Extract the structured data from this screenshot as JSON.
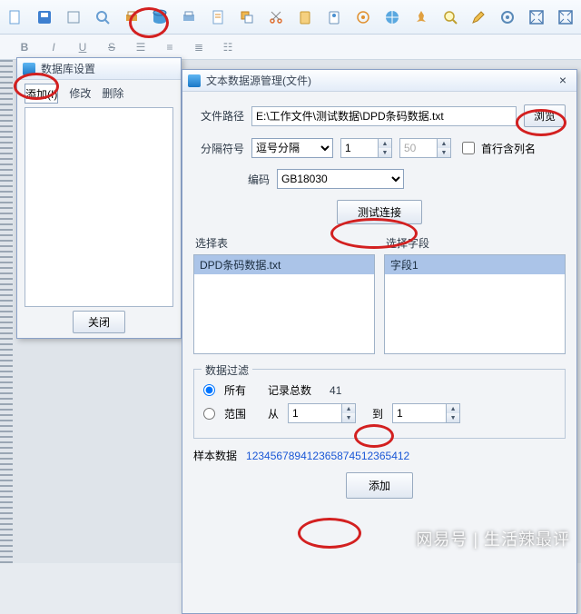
{
  "toolbar": {
    "icons": [
      "file",
      "save",
      "page",
      "zoom-in",
      "print",
      "database",
      "print2",
      "doc",
      "layers",
      "cut",
      "clip",
      "stamp",
      "target",
      "globe",
      "find",
      "edit",
      "settings",
      "fit",
      "fit2"
    ]
  },
  "format_bar": {
    "items": [
      "B",
      "I",
      "U",
      "S",
      "☰",
      "≡",
      "≣",
      "☷"
    ]
  },
  "db_dialog": {
    "title": "数据库设置",
    "add": "添加(I)",
    "modify": "修改",
    "delete": "删除",
    "close": "关闭"
  },
  "ds_dialog": {
    "title": "文本数据源管理(文件)",
    "path_label": "文件路径",
    "path_value": "E:\\工作文件\\测试数据\\DPD条码数据.txt",
    "browse": "浏览",
    "delim_label": "分隔符号",
    "delim_value": "逗号分隔",
    "spin1": "1",
    "spin2": "50",
    "first_row_cols": "首行含列名",
    "encoding_label": "编码",
    "encoding_value": "GB18030",
    "test_connection": "测试连接",
    "select_table": "选择表",
    "table_item": "DPD条码数据.txt",
    "select_field": "选择字段",
    "field_item": "字段1",
    "filter": {
      "legend": "数据过滤",
      "all": "所有",
      "total_label": "记录总数",
      "total_value": "41",
      "range": "范围",
      "from": "从",
      "to": "到",
      "from_v": "1",
      "to_v": "1"
    },
    "sample_label": "样本数据",
    "sample_value": "123456789412365874512365412",
    "add": "添加"
  },
  "watermark": "网易号 | 生活辣最评"
}
